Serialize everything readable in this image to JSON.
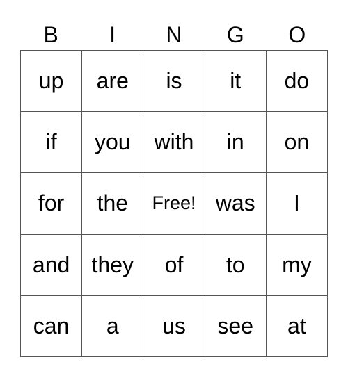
{
  "header": [
    "B",
    "I",
    "N",
    "G",
    "O"
  ],
  "cells": [
    [
      "up",
      "are",
      "is",
      "it",
      "do"
    ],
    [
      "if",
      "you",
      "with",
      "in",
      "on"
    ],
    [
      "for",
      "the",
      "Free!",
      "was",
      "I"
    ],
    [
      "and",
      "they",
      "of",
      "to",
      "my"
    ],
    [
      "can",
      "a",
      "us",
      "see",
      "at"
    ]
  ],
  "free_cell": {
    "row": 2,
    "col": 2
  }
}
